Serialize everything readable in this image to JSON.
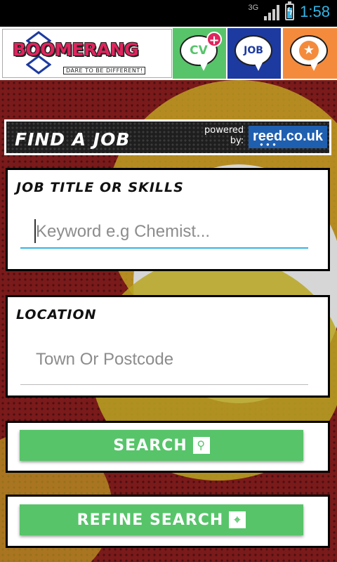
{
  "status_bar": {
    "network": "3G",
    "time": "1:58",
    "battery_level": 0.85
  },
  "header": {
    "logo_text": "BOOMERANG",
    "logo_tagline": "DARE TO BE DIFFERENT!",
    "buttons": [
      {
        "label": "CV",
        "icon": "cv-bubble-icon",
        "color": "#57c46a"
      },
      {
        "label": "JOB",
        "icon": "job-bubble-icon",
        "color": "#1d3aa0"
      },
      {
        "label": "",
        "icon": "star-bubble-icon",
        "color": "#f48b3c"
      }
    ]
  },
  "find_bar": {
    "title": "FIND A JOB",
    "powered_line1": "powered",
    "powered_line2": "by:",
    "brand": "reed.co.uk"
  },
  "job_card": {
    "label": "JOB TITLE OR SKILLS",
    "placeholder": "Keyword e.g Chemist...",
    "value": ""
  },
  "location_card": {
    "label": "LOCATION",
    "placeholder": "Town Or Postcode",
    "value": ""
  },
  "search_button": {
    "label": "SEARCH",
    "icon": "search-icon"
  },
  "refine_button": {
    "label": "REFINE SEARCH",
    "icon": "target-icon"
  },
  "colors": {
    "accent_green": "#57c46a",
    "accent_blue": "#1d3aa0",
    "accent_orange": "#f48b3c",
    "logo_pink": "#e0245e",
    "android_blue": "#33b5e5"
  }
}
